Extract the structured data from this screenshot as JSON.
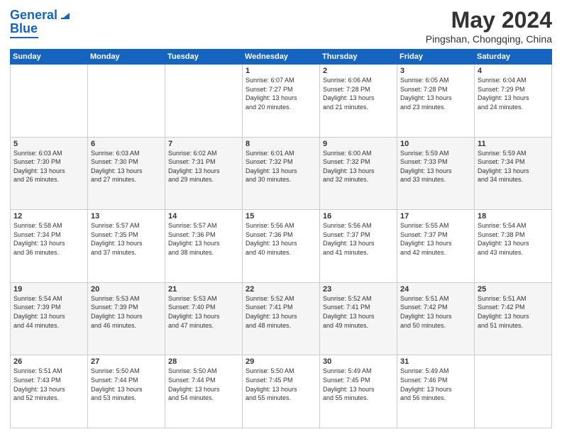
{
  "header": {
    "logo_line1": "General",
    "logo_line2": "Blue",
    "title": "May 2024",
    "location": "Pingshan, Chongqing, China"
  },
  "calendar": {
    "headers": [
      "Sunday",
      "Monday",
      "Tuesday",
      "Wednesday",
      "Thursday",
      "Friday",
      "Saturday"
    ],
    "rows": [
      [
        {
          "day": "",
          "text": ""
        },
        {
          "day": "",
          "text": ""
        },
        {
          "day": "",
          "text": ""
        },
        {
          "day": "1",
          "text": "Sunrise: 6:07 AM\nSunset: 7:27 PM\nDaylight: 13 hours\nand 20 minutes."
        },
        {
          "day": "2",
          "text": "Sunrise: 6:06 AM\nSunset: 7:28 PM\nDaylight: 13 hours\nand 21 minutes."
        },
        {
          "day": "3",
          "text": "Sunrise: 6:05 AM\nSunset: 7:28 PM\nDaylight: 13 hours\nand 23 minutes."
        },
        {
          "day": "4",
          "text": "Sunrise: 6:04 AM\nSunset: 7:29 PM\nDaylight: 13 hours\nand 24 minutes."
        }
      ],
      [
        {
          "day": "5",
          "text": "Sunrise: 6:03 AM\nSunset: 7:30 PM\nDaylight: 13 hours\nand 26 minutes."
        },
        {
          "day": "6",
          "text": "Sunrise: 6:03 AM\nSunset: 7:30 PM\nDaylight: 13 hours\nand 27 minutes."
        },
        {
          "day": "7",
          "text": "Sunrise: 6:02 AM\nSunset: 7:31 PM\nDaylight: 13 hours\nand 29 minutes."
        },
        {
          "day": "8",
          "text": "Sunrise: 6:01 AM\nSunset: 7:32 PM\nDaylight: 13 hours\nand 30 minutes."
        },
        {
          "day": "9",
          "text": "Sunrise: 6:00 AM\nSunset: 7:32 PM\nDaylight: 13 hours\nand 32 minutes."
        },
        {
          "day": "10",
          "text": "Sunrise: 5:59 AM\nSunset: 7:33 PM\nDaylight: 13 hours\nand 33 minutes."
        },
        {
          "day": "11",
          "text": "Sunrise: 5:59 AM\nSunset: 7:34 PM\nDaylight: 13 hours\nand 34 minutes."
        }
      ],
      [
        {
          "day": "12",
          "text": "Sunrise: 5:58 AM\nSunset: 7:34 PM\nDaylight: 13 hours\nand 36 minutes."
        },
        {
          "day": "13",
          "text": "Sunrise: 5:57 AM\nSunset: 7:35 PM\nDaylight: 13 hours\nand 37 minutes."
        },
        {
          "day": "14",
          "text": "Sunrise: 5:57 AM\nSunset: 7:36 PM\nDaylight: 13 hours\nand 38 minutes."
        },
        {
          "day": "15",
          "text": "Sunrise: 5:56 AM\nSunset: 7:36 PM\nDaylight: 13 hours\nand 40 minutes."
        },
        {
          "day": "16",
          "text": "Sunrise: 5:56 AM\nSunset: 7:37 PM\nDaylight: 13 hours\nand 41 minutes."
        },
        {
          "day": "17",
          "text": "Sunrise: 5:55 AM\nSunset: 7:37 PM\nDaylight: 13 hours\nand 42 minutes."
        },
        {
          "day": "18",
          "text": "Sunrise: 5:54 AM\nSunset: 7:38 PM\nDaylight: 13 hours\nand 43 minutes."
        }
      ],
      [
        {
          "day": "19",
          "text": "Sunrise: 5:54 AM\nSunset: 7:39 PM\nDaylight: 13 hours\nand 44 minutes."
        },
        {
          "day": "20",
          "text": "Sunrise: 5:53 AM\nSunset: 7:39 PM\nDaylight: 13 hours\nand 46 minutes."
        },
        {
          "day": "21",
          "text": "Sunrise: 5:53 AM\nSunset: 7:40 PM\nDaylight: 13 hours\nand 47 minutes."
        },
        {
          "day": "22",
          "text": "Sunrise: 5:52 AM\nSunset: 7:41 PM\nDaylight: 13 hours\nand 48 minutes."
        },
        {
          "day": "23",
          "text": "Sunrise: 5:52 AM\nSunset: 7:41 PM\nDaylight: 13 hours\nand 49 minutes."
        },
        {
          "day": "24",
          "text": "Sunrise: 5:51 AM\nSunset: 7:42 PM\nDaylight: 13 hours\nand 50 minutes."
        },
        {
          "day": "25",
          "text": "Sunrise: 5:51 AM\nSunset: 7:42 PM\nDaylight: 13 hours\nand 51 minutes."
        }
      ],
      [
        {
          "day": "26",
          "text": "Sunrise: 5:51 AM\nSunset: 7:43 PM\nDaylight: 13 hours\nand 52 minutes."
        },
        {
          "day": "27",
          "text": "Sunrise: 5:50 AM\nSunset: 7:44 PM\nDaylight: 13 hours\nand 53 minutes."
        },
        {
          "day": "28",
          "text": "Sunrise: 5:50 AM\nSunset: 7:44 PM\nDaylight: 13 hours\nand 54 minutes."
        },
        {
          "day": "29",
          "text": "Sunrise: 5:50 AM\nSunset: 7:45 PM\nDaylight: 13 hours\nand 55 minutes."
        },
        {
          "day": "30",
          "text": "Sunrise: 5:49 AM\nSunset: 7:45 PM\nDaylight: 13 hours\nand 55 minutes."
        },
        {
          "day": "31",
          "text": "Sunrise: 5:49 AM\nSunset: 7:46 PM\nDaylight: 13 hours\nand 56 minutes."
        },
        {
          "day": "",
          "text": ""
        }
      ]
    ]
  }
}
